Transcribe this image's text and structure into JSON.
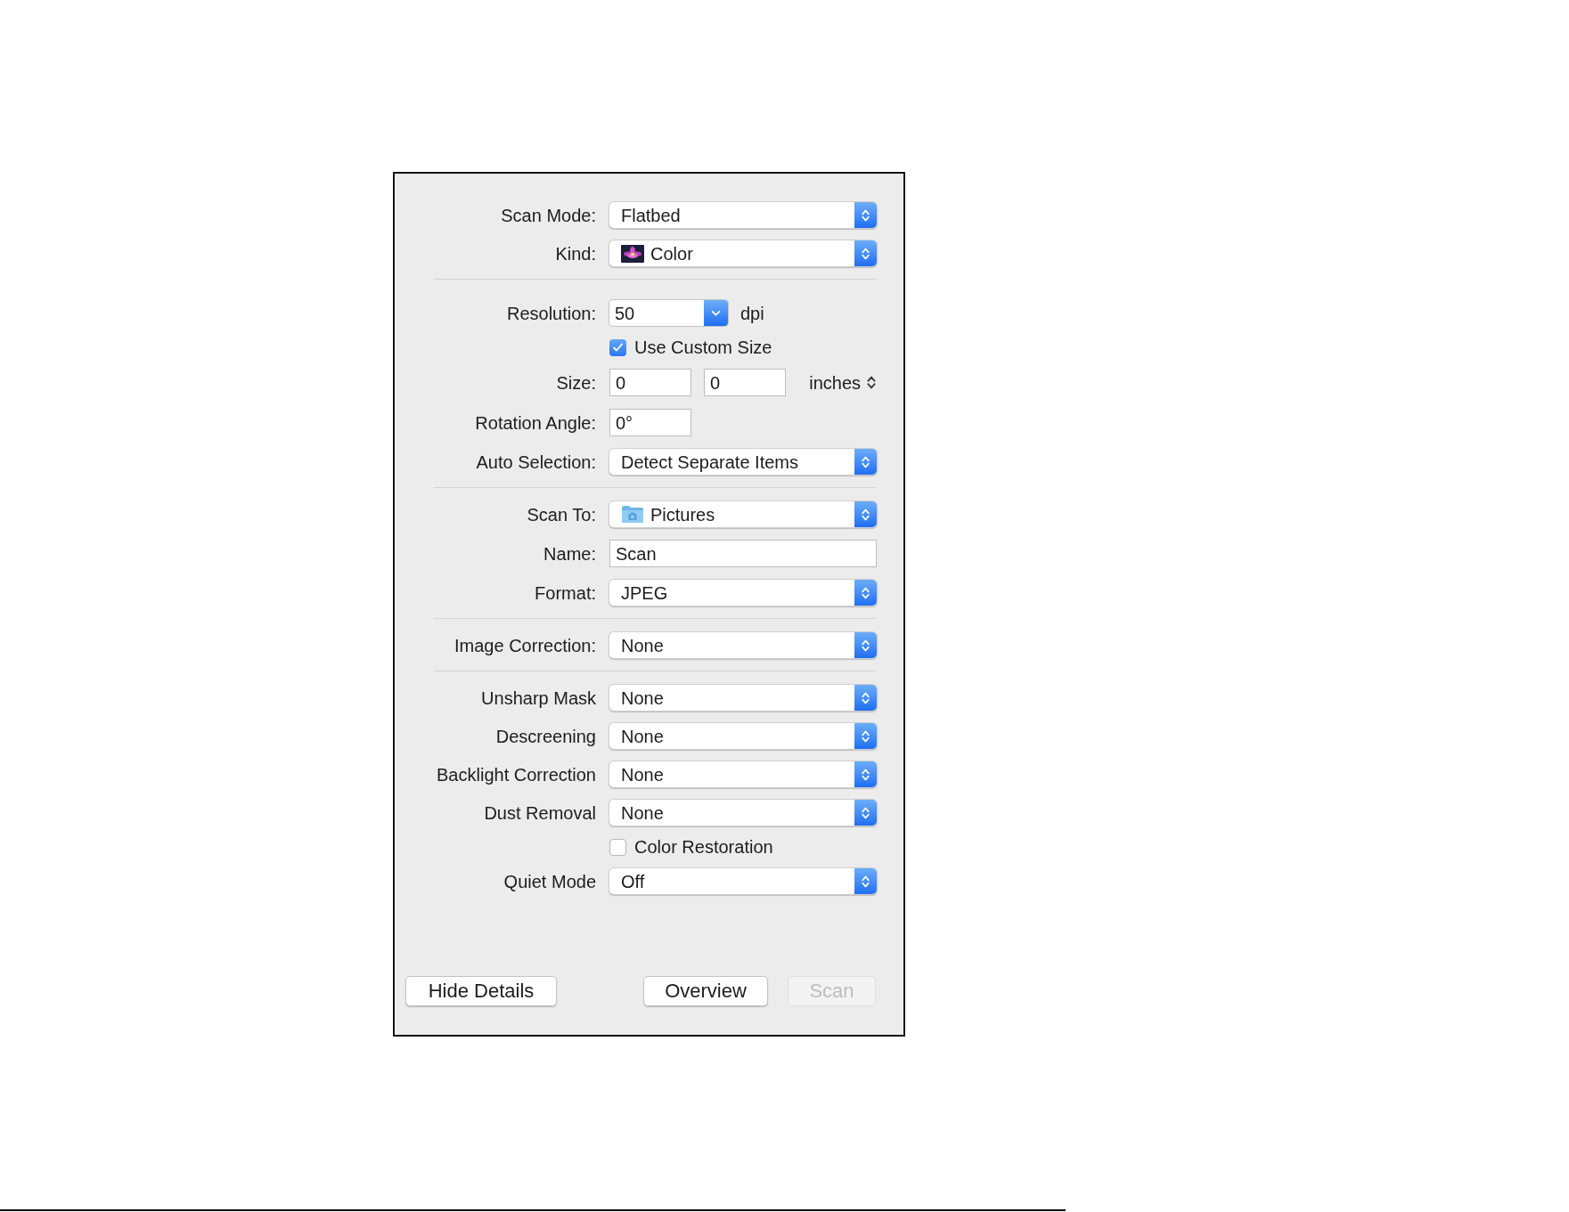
{
  "dialog": {
    "sections": [
      {
        "rows": [
          {
            "kind": "popup",
            "label": "Scan Mode:",
            "value": "Flatbed"
          },
          {
            "kind": "color_popup",
            "label": "Kind:",
            "value": "Color"
          }
        ]
      },
      {
        "rows": [
          {
            "kind": "combo",
            "label": "Resolution:",
            "value": "50",
            "unit": "dpi"
          },
          {
            "kind": "checkbox",
            "label": "Use Custom Size",
            "checked": true
          },
          {
            "kind": "size",
            "label": "Size:",
            "values": [
              "0",
              "0"
            ],
            "unit": "inches"
          },
          {
            "kind": "angle_field",
            "label": "Rotation Angle:",
            "value": "0°"
          },
          {
            "kind": "popup",
            "label": "Auto Selection:",
            "value": "Detect Separate Items"
          }
        ]
      },
      {
        "rows": [
          {
            "kind": "location_popup",
            "label": "Scan To:",
            "value": "Pictures"
          },
          {
            "kind": "text_field",
            "label": "Name:",
            "value": "Scan"
          },
          {
            "kind": "popup",
            "label": "Format:",
            "value": "JPEG"
          }
        ]
      },
      {
        "rows": [
          {
            "kind": "popup",
            "label": "Image Correction:",
            "value": "None"
          }
        ]
      },
      {
        "rows": [
          {
            "kind": "popup",
            "label": "Unsharp Mask",
            "value": "None"
          },
          {
            "kind": "popup",
            "label": "Descreening",
            "value": "None"
          },
          {
            "kind": "popup",
            "label": "Backlight Correction",
            "value": "None"
          },
          {
            "kind": "popup",
            "label": "Dust Removal",
            "value": "None"
          },
          {
            "kind": "checkbox",
            "label": "Color Restoration",
            "checked": false
          },
          {
            "kind": "popup",
            "label": "Quiet Mode",
            "value": "Off"
          }
        ]
      }
    ],
    "buttons_left": [
      {
        "label": "Hide Details",
        "disabled": false
      }
    ],
    "buttons_right": [
      {
        "label": "Overview",
        "disabled": false
      },
      {
        "label": "Scan",
        "disabled": true
      }
    ]
  }
}
